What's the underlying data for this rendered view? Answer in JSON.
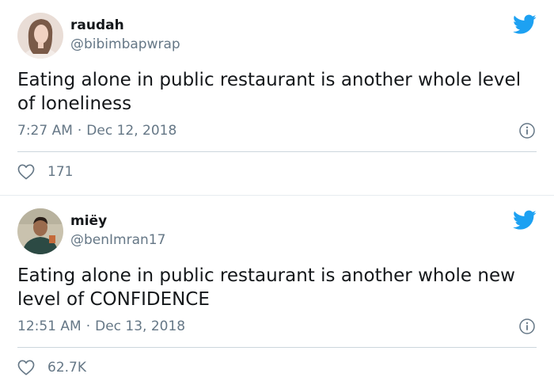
{
  "colors": {
    "twitter_blue": "#1da1f2",
    "secondary_text": "#657786",
    "primary_text": "#14171a",
    "divider": "#ccd6dd"
  },
  "icons": {
    "brand": "twitter-bird-icon",
    "info": "info-icon",
    "like": "heart-icon"
  },
  "tweets": [
    {
      "display_name": "raudah",
      "handle": "@bibimbapwrap",
      "text": "Eating alone in public restaurant is another whole level of loneliness",
      "time": "7:27 AM",
      "separator": "·",
      "date": "Dec 12, 2018",
      "likes": "171"
    },
    {
      "display_name": "miëy",
      "handle": "@benImran17",
      "text": "Eating alone in public restaurant is another whole new level of CONFIDENCE",
      "time": "12:51 AM",
      "separator": "·",
      "date": "Dec 13, 2018",
      "likes": "62.7K"
    }
  ]
}
